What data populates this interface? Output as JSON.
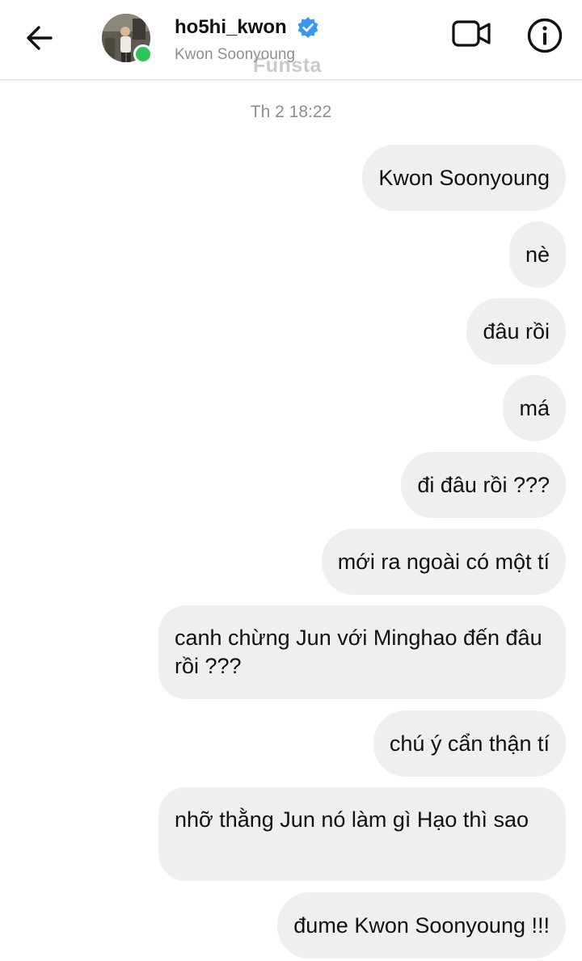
{
  "header": {
    "username": "ho5hi_kwon",
    "subtitle": "Kwon Soonyoung",
    "watermark": "Funsta",
    "back_icon": "arrow-left-icon",
    "video_icon": "video-camera-icon",
    "info_icon": "info-circle-icon",
    "verified_icon": "verified-badge-icon",
    "online_color": "#2ec45a",
    "verified_color": "#3897f0"
  },
  "thread": {
    "timestamp": "Th 2 18:22",
    "bubble_color": "#efefef",
    "messages": [
      {
        "text": "Kwon Soonyoung"
      },
      {
        "text": "nè"
      },
      {
        "text": "đâu rồi"
      },
      {
        "text": "má"
      },
      {
        "text": "đi đâu rồi ???"
      },
      {
        "text": "mới ra ngoài có một tí"
      },
      {
        "text": "canh chừng Jun với Minghao đến đâu rồi ???"
      },
      {
        "text": "chú ý cẩn thận tí"
      },
      {
        "text": "nhỡ thằng Jun nó làm gì Hạo thì sao"
      },
      {
        "text": "đume Kwon Soonyoung !!!"
      }
    ]
  }
}
